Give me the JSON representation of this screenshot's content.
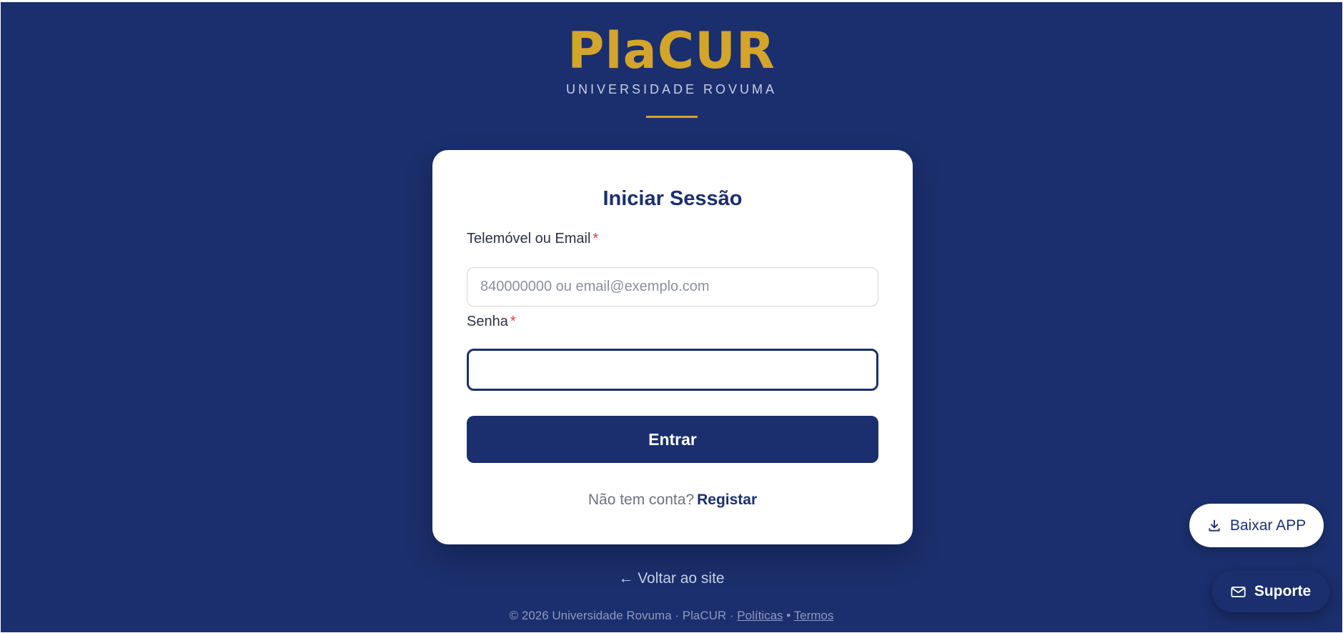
{
  "brand": {
    "logo": "PlaCUR",
    "subtitle": "UNIVERSIDADE ROVUMA"
  },
  "login": {
    "title": "Iniciar Sessão",
    "email_label": "Telemóvel ou Email",
    "email_placeholder": "840000000 ou email@exemplo.com",
    "email_value": "",
    "password_label": "Senha",
    "password_value": "",
    "required_marker": "*",
    "submit_label": "Entrar",
    "no_account_text": "Não tem conta?",
    "register_label": "Registar"
  },
  "links": {
    "back_to_site": "← Voltar ao site"
  },
  "footer": {
    "copyright": "© 2026 Universidade Rovuma · PlaCUR ·",
    "policies": "Políticas",
    "separator": "•",
    "terms": "Termos"
  },
  "floating": {
    "download_app": "Baixar APP",
    "download_icon": "download-icon",
    "support": "Suporte",
    "support_icon": "mail-icon"
  },
  "colors": {
    "background": "#1b2f6e",
    "accent_gold": "#d3a52c",
    "primary": "#1b2f6e",
    "required": "#e23b3b"
  }
}
